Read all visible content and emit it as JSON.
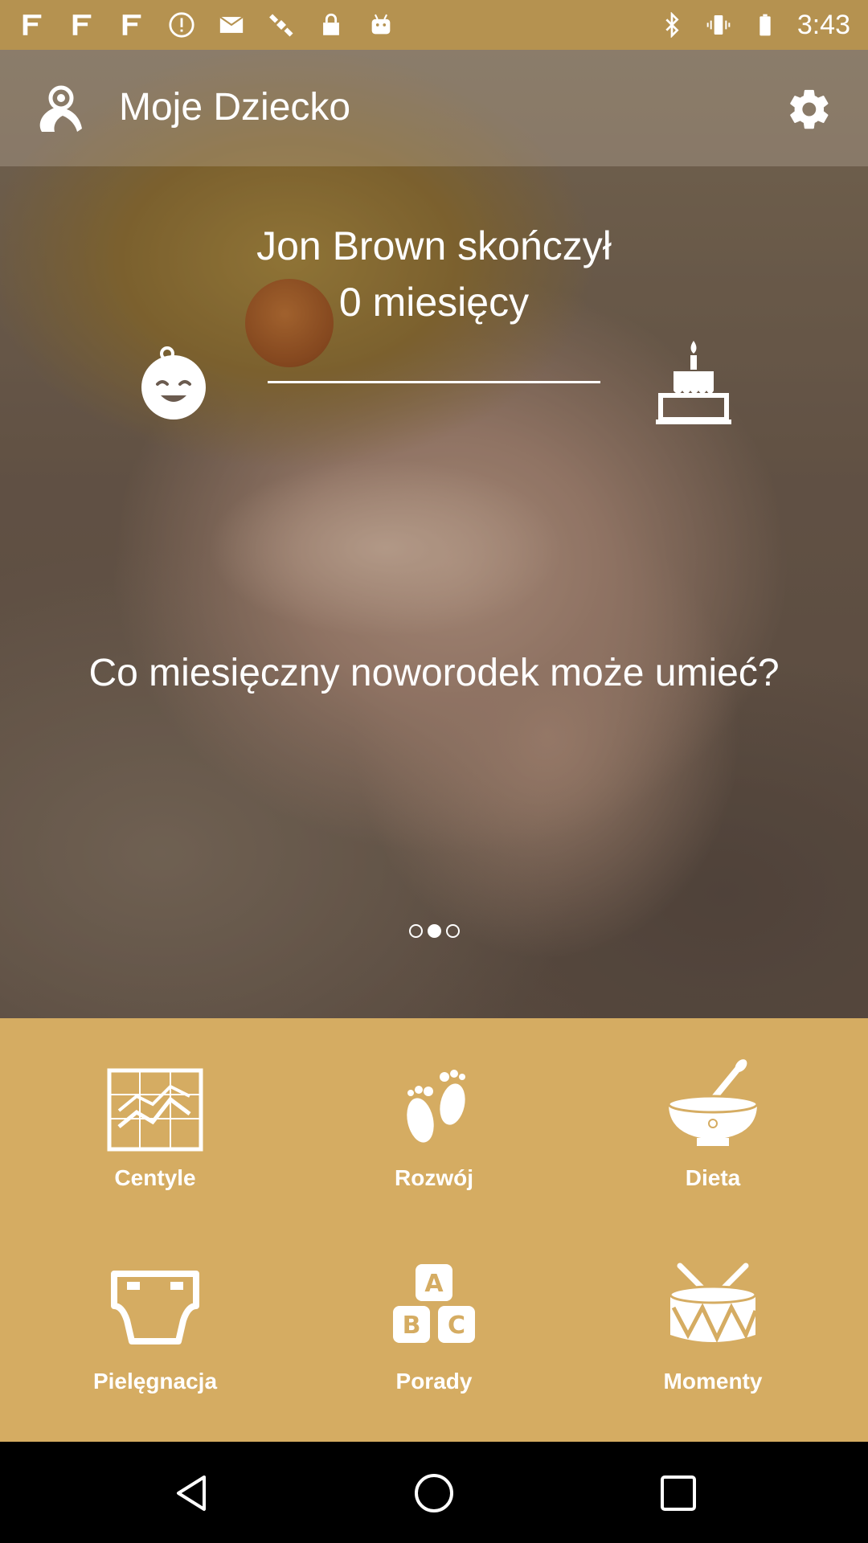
{
  "status_bar": {
    "time": "3:43",
    "left_icons": [
      "fan-icon",
      "fan-icon",
      "fan-icon",
      "alert-icon",
      "mail-icon",
      "satellite-icon",
      "lock-icon",
      "android-icon"
    ],
    "right_icons": [
      "bluetooth-icon",
      "vibrate-icon",
      "battery-icon"
    ]
  },
  "app_bar": {
    "title": "Moje Dziecko",
    "logo_icon": "baby-logo-icon",
    "settings_icon": "gear-icon"
  },
  "hero": {
    "age_line1": "Jon Brown skończył",
    "age_line2": "0 miesięcy",
    "age_progress": 0,
    "question": "Co miesięczny noworodek może umieć?",
    "pager": {
      "count": 3,
      "active_index": 1
    }
  },
  "menu": {
    "tiles": [
      {
        "label": "Centyle",
        "icon": "chart-icon"
      },
      {
        "label": "Rozwój",
        "icon": "footprints-icon"
      },
      {
        "label": "Dieta",
        "icon": "bowl-spoon-icon"
      },
      {
        "label": "Pielęgnacja",
        "icon": "diaper-icon"
      },
      {
        "label": "Porady",
        "icon": "abc-blocks-icon"
      },
      {
        "label": "Momenty",
        "icon": "drum-icon"
      }
    ]
  },
  "nav_bar": {
    "buttons": [
      "back-icon",
      "home-icon",
      "recents-icon"
    ]
  },
  "colors": {
    "status_bar": "#b59250",
    "menu_background": "#d5ac62",
    "text": "#ffffff"
  }
}
